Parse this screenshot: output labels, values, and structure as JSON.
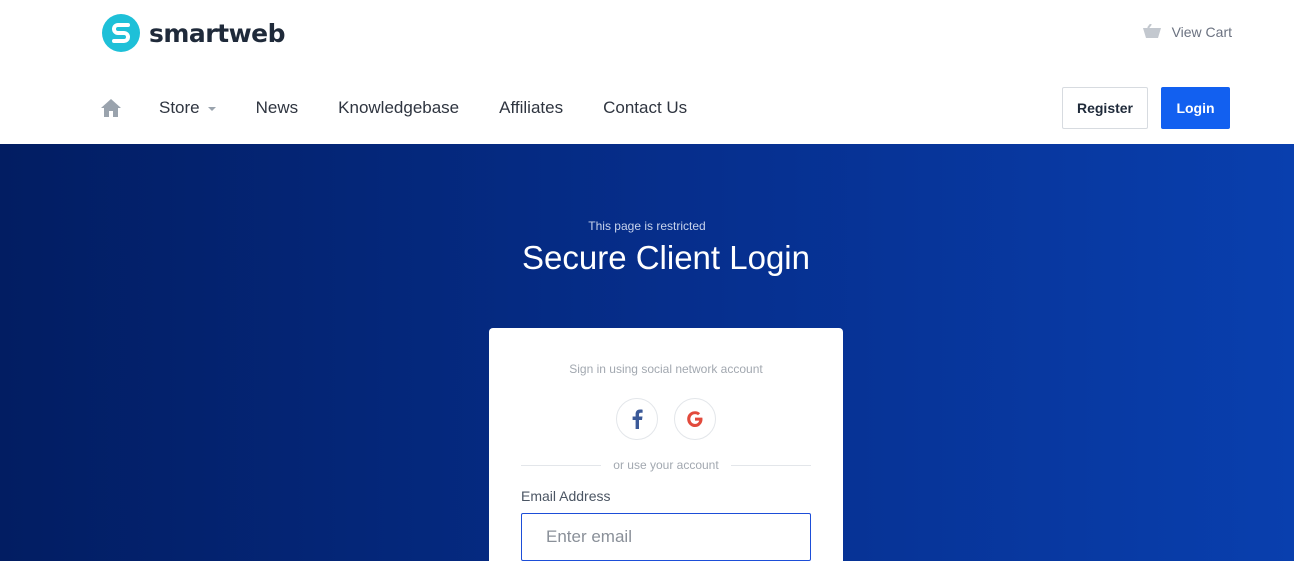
{
  "brand": {
    "name": "smartweb",
    "color": "#1ec0d8"
  },
  "header": {
    "cart_label": "View Cart",
    "nav": [
      {
        "label": "Store",
        "has_dropdown": true
      },
      {
        "label": "News"
      },
      {
        "label": "Knowledgebase"
      },
      {
        "label": "Affiliates"
      },
      {
        "label": "Contact Us"
      }
    ],
    "register_label": "Register",
    "login_label": "Login"
  },
  "hero": {
    "kicker": "This page is restricted",
    "title": "Secure Client Login"
  },
  "login_card": {
    "social_caption": "Sign in using social network account",
    "social": [
      {
        "name": "facebook",
        "icon": "facebook-icon",
        "color": "#3b5998"
      },
      {
        "name": "google",
        "icon": "google-icon",
        "color": "#e24a3c"
      }
    ],
    "divider_text": "or use your account",
    "email_label": "Email Address",
    "email_placeholder": "Enter email",
    "email_value": ""
  },
  "colors": {
    "primary": "#1260f0",
    "hero_start": "#021d62",
    "hero_end": "#093fae"
  }
}
